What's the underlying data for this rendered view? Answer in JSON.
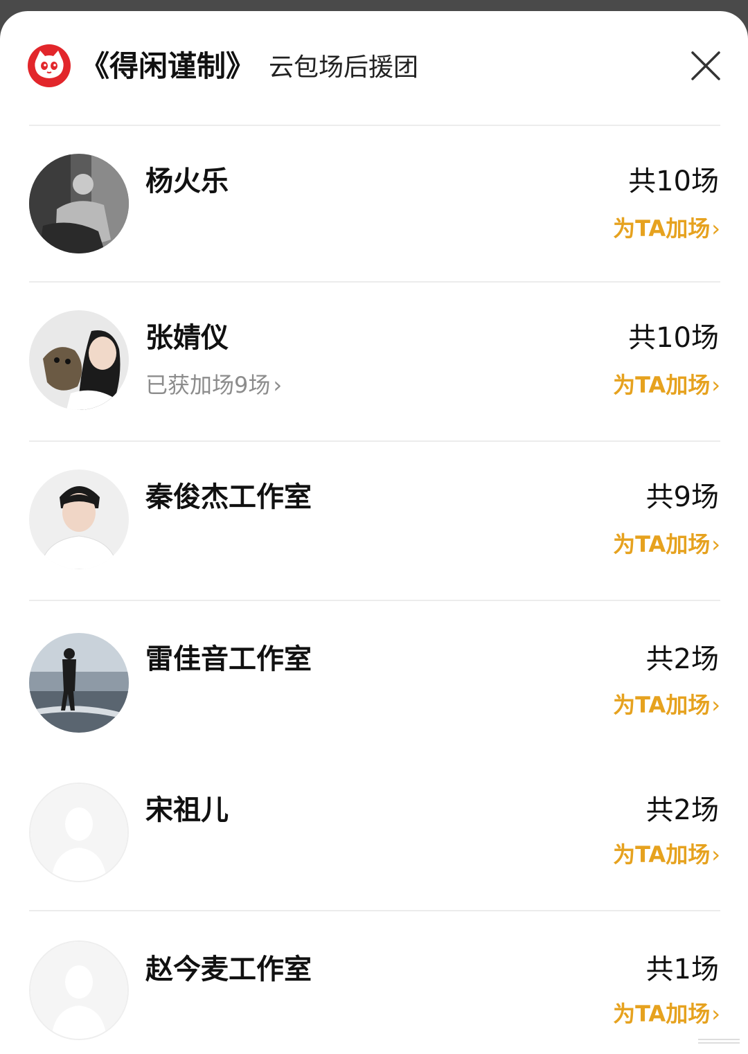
{
  "header": {
    "title": "《得闲谨制》",
    "subtitle": "云包场后援团",
    "logo_icon": "cat-logo-icon",
    "close_icon": "close-icon"
  },
  "colors": {
    "accent": "#e6a21f",
    "logo_red": "#e2262b",
    "divider": "#ececec"
  },
  "supporters": [
    {
      "name": "杨火乐",
      "total": "共10场",
      "action": "为TA加场",
      "extra": ""
    },
    {
      "name": "张婧仪",
      "total": "共10场",
      "action": "为TA加场",
      "extra": "已获加场9场"
    },
    {
      "name": "秦俊杰工作室",
      "total": "共9场",
      "action": "为TA加场",
      "extra": ""
    },
    {
      "name": "雷佳音工作室",
      "total": "共2场",
      "action": "为TA加场",
      "extra": ""
    },
    {
      "name": "宋祖儿",
      "total": "共2场",
      "action": "为TA加场",
      "extra": ""
    },
    {
      "name": "赵今麦工作室",
      "total": "共1场",
      "action": "为TA加场",
      "extra": ""
    }
  ],
  "icons": {
    "chevron": "›"
  }
}
